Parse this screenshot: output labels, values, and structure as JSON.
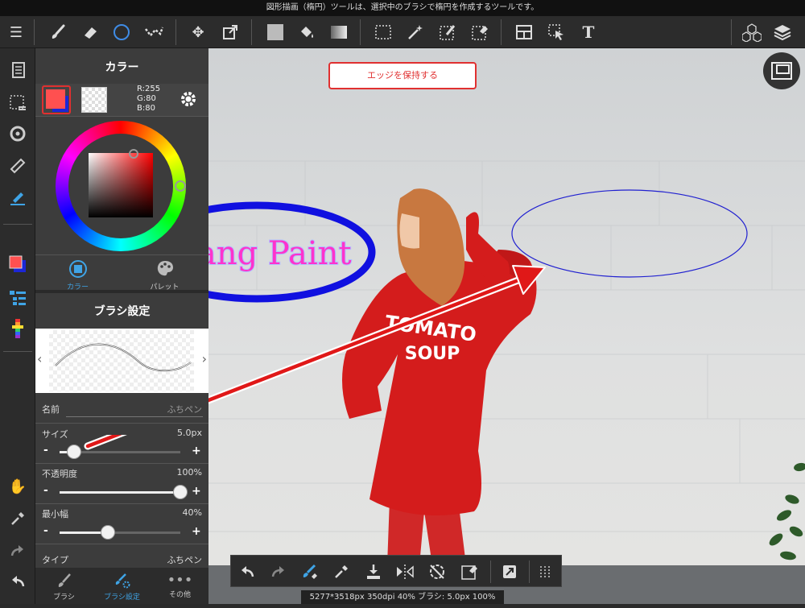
{
  "top_message": "図形描画（楕円）ツールは、選択中のブラシで楕円を作成するツールです。",
  "color_panel": {
    "title": "カラー",
    "rgb_r": "R:255",
    "rgb_g": "G:80",
    "rgb_b": "B:80",
    "primary_color": "#ff5050",
    "tab_color": "カラー",
    "tab_palette": "パレット"
  },
  "brush_panel": {
    "title": "ブラシ設定",
    "name_label": "名前",
    "name_value": "ふちペン",
    "size_label": "サイズ",
    "size_value": "5.0px",
    "size_level": 0.12,
    "opacity_label": "不透明度",
    "opacity_value": "100%",
    "opacity_level": 1.0,
    "minwidth_label": "最小幅",
    "minwidth_value": "40%",
    "minwidth_level": 0.4,
    "type_label": "タイプ",
    "type_value": "ふちペン"
  },
  "bottom_tabs": {
    "brush": "ブラシ",
    "brush_settings": "ブラシ設定",
    "other": "その他"
  },
  "canvas": {
    "edge_button": "エッジを保持する",
    "text_partial": "ang Paint",
    "shirt_line1": "TOMATO",
    "shirt_line2": "SOUP"
  },
  "status": "5277*3518px 350dpi 40% ブラシ: 5.0px 100%",
  "icons": {
    "toolbar": [
      "menu-icon",
      "brush-icon",
      "eraser-icon",
      "ellipse-icon",
      "dotted-line-icon",
      "move-icon",
      "transform-icon",
      "fill-color-icon",
      "bucket-icon",
      "gradient-icon",
      "select-rect-icon",
      "magic-wand-icon",
      "select-pen-icon",
      "select-eraser-icon",
      "layout-icon",
      "select-pointer-icon",
      "text-icon",
      "3d-icon",
      "layers-icon"
    ]
  }
}
